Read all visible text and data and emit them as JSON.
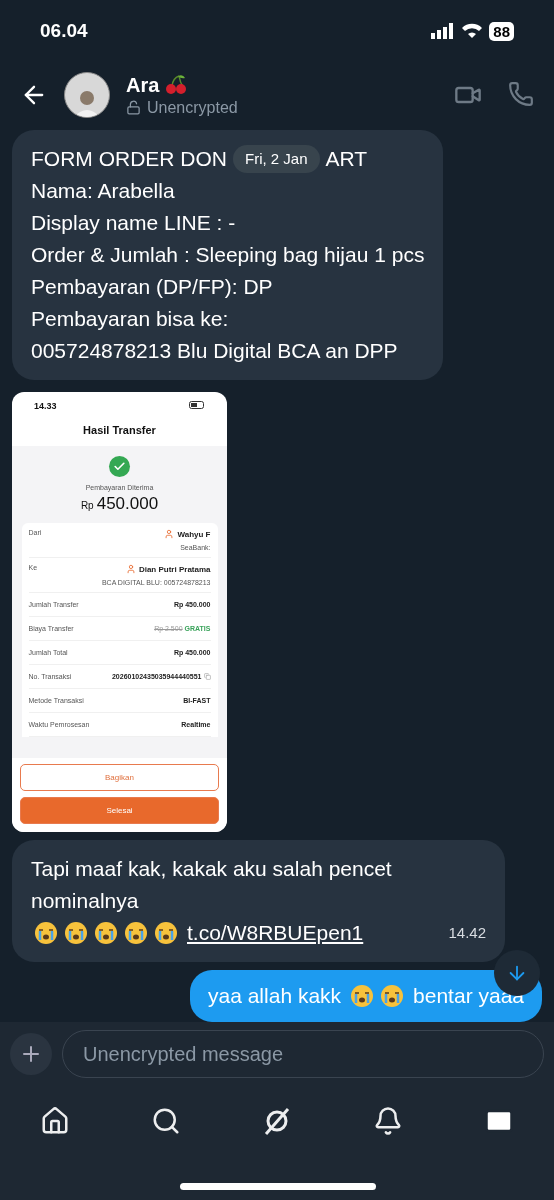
{
  "status_bar": {
    "time": "06.04",
    "battery": "88"
  },
  "header": {
    "name": "Ara",
    "status": "Unencrypted"
  },
  "messages": [
    {
      "kind": "form",
      "first_line": [
        "FORM ORDER DON",
        "ART"
      ],
      "date_pill": "Fri, 2 Jan",
      "lines": [
        "Nama: Arabella",
        "Display name LINE : -",
        "Order & Jumlah : Sleeping bag hijau 1 pcs",
        "Pembayaran (DP/FP): DP",
        "Pembayaran bisa ke:",
        "005724878213 Blu Digital BCA an DPP"
      ]
    },
    {
      "kind": "screenshot",
      "time": "14.33",
      "title": "Hasil Transfer",
      "status": "Pembayaran Diterima",
      "currency": "Rp",
      "amount": "450.000",
      "rows": [
        {
          "kind": "party",
          "label": "Dari",
          "value": "Wahyu F",
          "sub": "SeaBank:"
        },
        {
          "kind": "party",
          "label": "Ke",
          "value": "Dian Putri Pratama",
          "sub": "BCA DIGITAL BLU: 005724878213"
        },
        {
          "kind": "plain",
          "label": "Jumlah Transfer",
          "value": "Rp 450.000"
        },
        {
          "kind": "fee",
          "label": "Biaya Transfer",
          "struck": "Rp 2.500",
          "value": "GRATIS"
        },
        {
          "kind": "plain",
          "label": "Jumlah Total",
          "value": "Rp 450.000"
        },
        {
          "kind": "copy",
          "label": "No. Transaksi",
          "value": "20260102435035944440551"
        },
        {
          "kind": "plain",
          "label": "Metode Transaksi",
          "value": "BI-FAST"
        },
        {
          "kind": "plain",
          "label": "Waktu Pemrosesan",
          "value": "Realtime"
        }
      ],
      "buttons": [
        {
          "kind": "outline",
          "label": "Bagikan"
        },
        {
          "kind": "filled",
          "label": "Selesai"
        }
      ]
    },
    {
      "kind": "text",
      "outgoing": false,
      "text": "Tapi maaf kak, kakak aku salah pencet nominalnya",
      "emojis": [
        {
          "kind": "crying"
        },
        {
          "kind": "crying"
        },
        {
          "kind": "crying"
        },
        {
          "kind": "crying"
        },
        {
          "kind": "crying"
        }
      ],
      "link": "t.co/W8RBUEpen1",
      "time": "14.42"
    },
    {
      "kind": "text",
      "outgoing": true,
      "text": "yaa allah kakk",
      "emojis": [
        {
          "kind": "crying"
        },
        {
          "kind": "crying"
        }
      ],
      "text_after": "bentar yaaa"
    }
  ],
  "composer": {
    "placeholder": "Unencrypted message"
  },
  "nav": [
    {
      "kind": "home",
      "selected": false
    },
    {
      "kind": "search",
      "selected": false
    },
    {
      "kind": "grok",
      "selected": false
    },
    {
      "kind": "bell",
      "selected": false
    },
    {
      "kind": "mail",
      "selected": true
    }
  ]
}
